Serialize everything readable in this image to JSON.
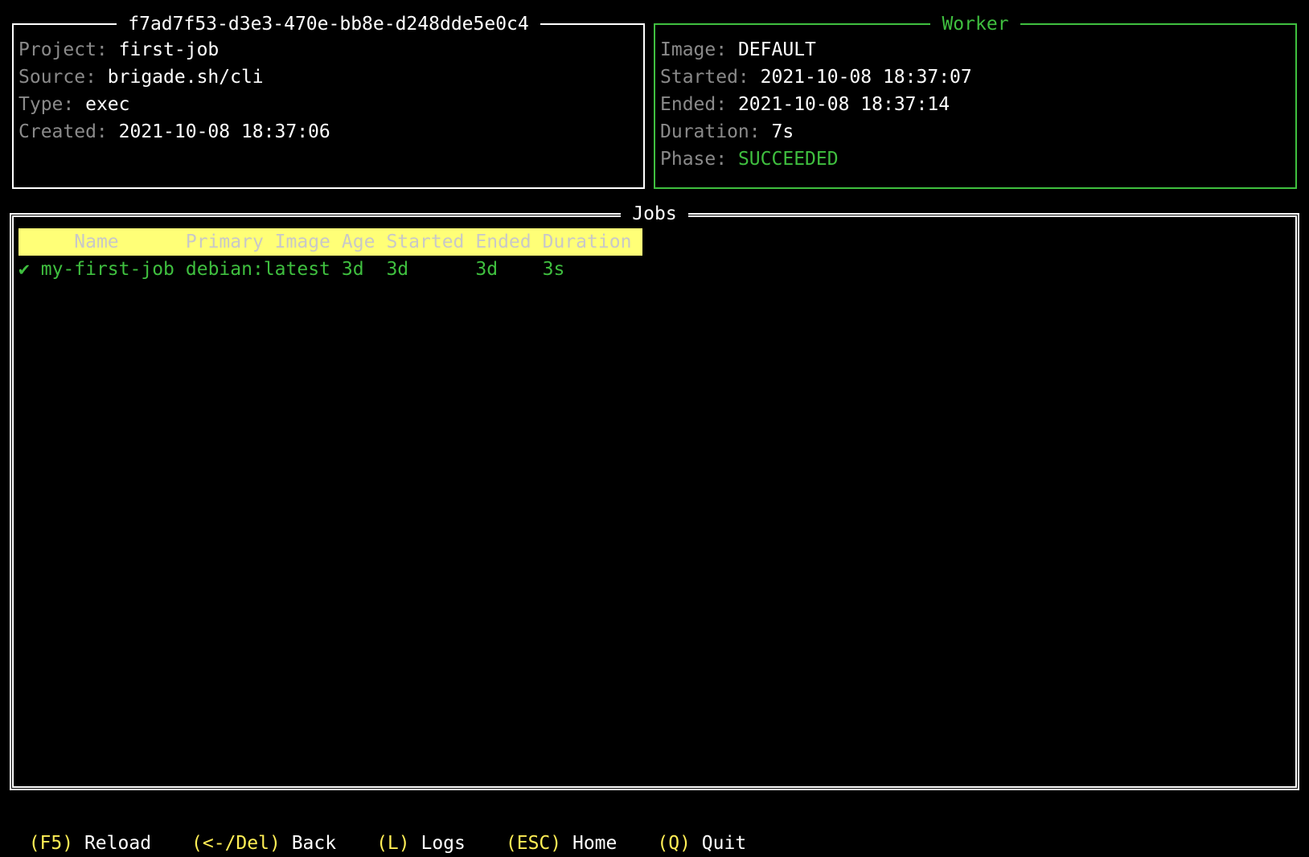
{
  "build": {
    "title": "f7ad7f53-d3e3-470e-bb8e-d248dde5e0c4",
    "fields": [
      {
        "label": "Project:",
        "value": "first-job"
      },
      {
        "label": "Source:",
        "value": "brigade.sh/cli"
      },
      {
        "label": "Type:",
        "value": "exec"
      },
      {
        "label": "Created:",
        "value": "2021-10-08 18:37:06"
      }
    ]
  },
  "worker": {
    "title": "Worker",
    "fields": [
      {
        "label": "Image:",
        "value": "DEFAULT"
      },
      {
        "label": "Started:",
        "value": "2021-10-08 18:37:07"
      },
      {
        "label": "Ended:",
        "value": "2021-10-08 18:37:14"
      },
      {
        "label": "Duration:",
        "value": "7s"
      },
      {
        "label": "Phase:",
        "value": "SUCCEEDED"
      }
    ]
  },
  "jobs": {
    "title": "Jobs",
    "columns": [
      "Name",
      "Primary Image",
      "Age",
      "Started",
      "Ended",
      "Duration"
    ],
    "rows": [
      {
        "status_icon": "✔",
        "name": "my-first-job",
        "image": "debian:latest",
        "age": "3d",
        "started": "3d",
        "ended": "3d",
        "duration": "3s"
      }
    ]
  },
  "footer": [
    {
      "key": "(F5)",
      "action": "Reload"
    },
    {
      "key": "(<-/Del)",
      "action": "Back"
    },
    {
      "key": "(L)",
      "action": "Logs"
    },
    {
      "key": "(ESC)",
      "action": "Home"
    },
    {
      "key": "(Q)",
      "action": "Quit"
    }
  ],
  "colors": {
    "background": "#000000",
    "label": "#8a8a8a",
    "value": "#ffffff",
    "success": "#3fbf3f",
    "header_bg": "#ffff77",
    "key": "#ffee55"
  }
}
